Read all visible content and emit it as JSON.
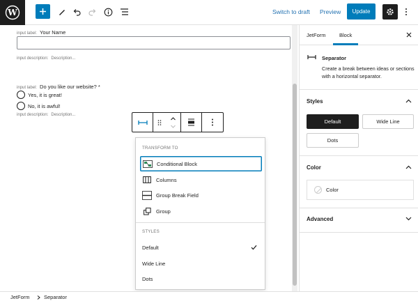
{
  "topbar": {
    "switch_to_draft": "Switch to draft",
    "preview": "Preview",
    "update": "Update",
    "icons": [
      "wordpress-logo",
      "plus-icon",
      "pencil-icon",
      "undo-icon",
      "redo-icon",
      "info-icon",
      "list-view-icon",
      "gear-icon",
      "more-vertical-icon"
    ]
  },
  "form": {
    "field1": {
      "input_label_caption": "input label:",
      "label": "Your Name",
      "description_caption": "input description:",
      "description": "Description..."
    },
    "field2": {
      "input_label_caption": "input label:",
      "label": "Do you like our website? *",
      "options": [
        "Yes, it is great!",
        "No, it is awful!"
      ],
      "description_caption": "input description:",
      "description": "Description..."
    }
  },
  "dropdown": {
    "transform_heading": "TRANSFORM TO",
    "transform_items": [
      {
        "label": "Conditional Block",
        "icon": "conditional-block-icon"
      },
      {
        "label": "Columns",
        "icon": "columns-icon"
      },
      {
        "label": "Group Break Field",
        "icon": "group-break-icon"
      },
      {
        "label": "Group",
        "icon": "group-icon"
      }
    ],
    "styles_heading": "STYLES",
    "style_items": [
      {
        "label": "Default",
        "selected": true
      },
      {
        "label": "Wide Line",
        "selected": false
      },
      {
        "label": "Dots",
        "selected": false
      }
    ]
  },
  "sidebar": {
    "tabs": [
      "JetForm",
      "Block"
    ],
    "active_tab": "Block",
    "block_title": "Separator",
    "block_description": "Create a break between ideas or sections with a horizontal separator.",
    "styles_section": "Styles",
    "style_buttons": [
      "Default",
      "Wide Line",
      "Dots"
    ],
    "color_section": "Color",
    "color_item": "Color",
    "advanced_section": "Advanced"
  },
  "breadcrumb": [
    "JetForm",
    "Separator"
  ],
  "colors": {
    "accent": "#007cba",
    "dark": "#1e1e1e",
    "link": "#2271b1"
  }
}
